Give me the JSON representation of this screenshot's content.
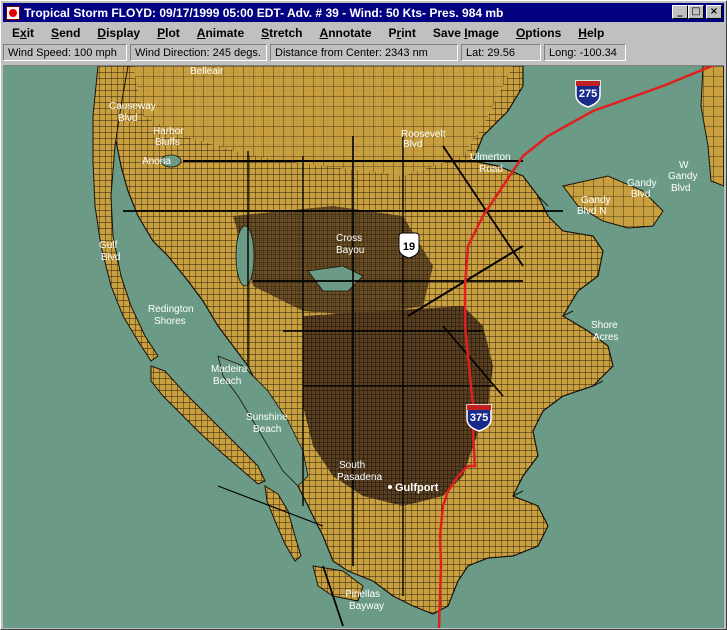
{
  "window": {
    "title": "Tropical Storm FLOYD: 09/17/1999 05:00 EDT- Adv. # 39 - Wind: 50 Kts- Pres. 984 mb",
    "minimize": "_",
    "maximize": "□",
    "close": "×"
  },
  "menu": [
    {
      "label": "Exit",
      "u": "x"
    },
    {
      "label": "Send",
      "u": "S"
    },
    {
      "label": "Display",
      "u": "D"
    },
    {
      "label": "Plot",
      "u": "P"
    },
    {
      "label": "Animate",
      "u": "A"
    },
    {
      "label": "Stretch",
      "u": "S"
    },
    {
      "label": "Annotate",
      "u": "A"
    },
    {
      "label": "Print",
      "u": "r"
    },
    {
      "label": "Save Image",
      "u": "I"
    },
    {
      "label": "Options",
      "u": "O"
    },
    {
      "label": "Help",
      "u": "H"
    }
  ],
  "status": {
    "wind_speed": "Wind Speed: 100 mph",
    "wind_direction": "Wind Direction: 245 degs.",
    "distance": "Distance from Center: 2343 nm",
    "lat": "Lat: 29.56",
    "long": "Long: -100.34"
  },
  "colors": {
    "water": "#6b9b86",
    "land": "#c8a040",
    "roads": "#1a1208",
    "interstate": "#e02020",
    "title_bar": "#000080"
  },
  "map": {
    "places": [
      {
        "id": "belleair",
        "text": "Belleair"
      },
      {
        "id": "causeway",
        "text": "Causeway"
      },
      {
        "id": "blvd1",
        "text": "Blvd"
      },
      {
        "id": "harbor",
        "text": "Harbor"
      },
      {
        "id": "bluffs",
        "text": "Bluffs"
      },
      {
        "id": "anona",
        "text": "Anona"
      },
      {
        "id": "roosevelt",
        "text": "Roosevelt"
      },
      {
        "id": "blvd2",
        "text": "Blvd"
      },
      {
        "id": "gandy1",
        "text": "Gandy"
      },
      {
        "id": "gandy_blvd",
        "text": "Blvd"
      },
      {
        "id": "w",
        "text": "W"
      },
      {
        "id": "gandy2",
        "text": "Gandy"
      },
      {
        "id": "blvd3",
        "text": "Blvd"
      },
      {
        "id": "gandy3",
        "text": "Gandy"
      },
      {
        "id": "blvd_n",
        "text": "Blvd N"
      },
      {
        "id": "ulmerton",
        "text": "Ulmerton"
      },
      {
        "id": "road",
        "text": "Road"
      },
      {
        "id": "cross",
        "text": "Cross"
      },
      {
        "id": "bayou",
        "text": "Bayou"
      },
      {
        "id": "gulf",
        "text": "Gulf"
      },
      {
        "id": "blvd4",
        "text": "Blvd"
      },
      {
        "id": "redington",
        "text": "Redington"
      },
      {
        "id": "shores",
        "text": "Shores"
      },
      {
        "id": "madeira",
        "text": "Madeira"
      },
      {
        "id": "beach1",
        "text": "Beach"
      },
      {
        "id": "sunshine",
        "text": "Sunshine"
      },
      {
        "id": "beach2",
        "text": "Beach"
      },
      {
        "id": "south",
        "text": "South"
      },
      {
        "id": "pasadena",
        "text": "Pasadena"
      },
      {
        "id": "gulfport",
        "text": "Gulfport"
      },
      {
        "id": "shore",
        "text": "Shore"
      },
      {
        "id": "acres",
        "text": "Acres"
      },
      {
        "id": "pinellas",
        "text": "Pinellas"
      },
      {
        "id": "byway",
        "text": "Bayway"
      }
    ],
    "shields": [
      {
        "id": "i275",
        "text": "275"
      },
      {
        "id": "us19",
        "text": "19"
      },
      {
        "id": "i375",
        "text": "375"
      }
    ]
  }
}
